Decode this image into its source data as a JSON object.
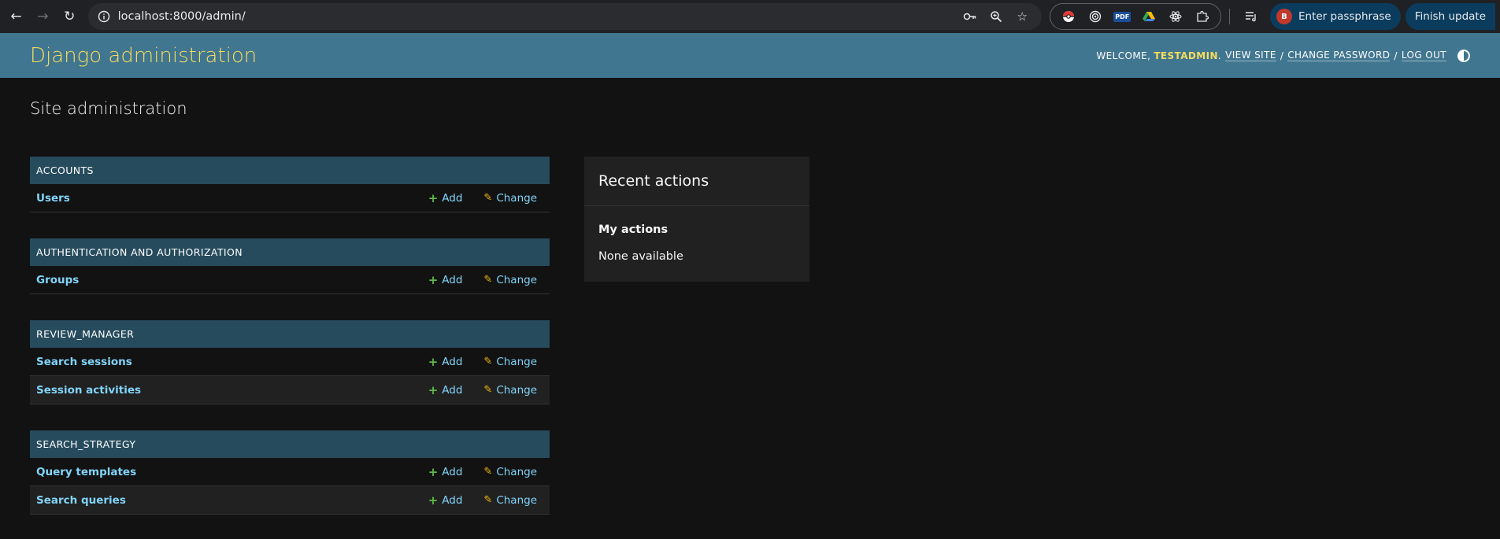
{
  "browser": {
    "url": "localhost:8000/admin/",
    "passphrase_label": "Enter passphrase",
    "profile_initial": "B",
    "update_label": "Finish update",
    "pdf_badge": "PDF"
  },
  "header": {
    "branding": "Django administration",
    "welcome": "WELCOME,",
    "username": "TESTADMIN",
    "period": ".",
    "view_site": "VIEW SITE",
    "change_password": "CHANGE PASSWORD",
    "log_out": "LOG OUT",
    "separator": "/"
  },
  "page": {
    "title": "Site administration"
  },
  "modules": [
    {
      "caption": "ACCOUNTS",
      "models": [
        {
          "name": "Users"
        }
      ]
    },
    {
      "caption": "AUTHENTICATION AND AUTHORIZATION",
      "models": [
        {
          "name": "Groups"
        }
      ]
    },
    {
      "caption": "REVIEW_MANAGER",
      "models": [
        {
          "name": "Search sessions"
        },
        {
          "name": "Session activities"
        }
      ]
    },
    {
      "caption": "SEARCH_STRATEGY",
      "models": [
        {
          "name": "Query templates"
        },
        {
          "name": "Search queries"
        }
      ]
    }
  ],
  "actions": {
    "add": "Add",
    "change": "Change"
  },
  "recent": {
    "title": "Recent actions",
    "subtitle": "My actions",
    "empty": "None available"
  },
  "colors": {
    "header_bg": "#417690",
    "brand": "#f5dd5d",
    "caption_bg": "#264b5d",
    "link": "#81d4fa",
    "add": "#5dbb46",
    "change": "#efb80b"
  }
}
